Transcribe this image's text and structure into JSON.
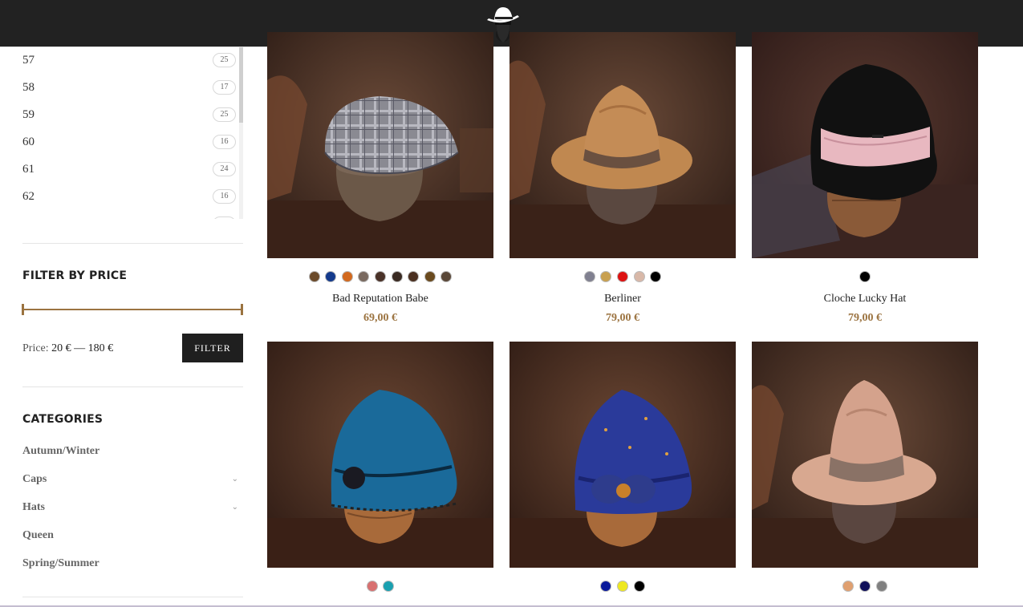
{
  "sizes": [
    {
      "label": "57",
      "count": "25"
    },
    {
      "label": "58",
      "count": "17"
    },
    {
      "label": "59",
      "count": "25"
    },
    {
      "label": "60",
      "count": "16"
    },
    {
      "label": "61",
      "count": "24"
    },
    {
      "label": "62",
      "count": "16"
    }
  ],
  "price_filter": {
    "title": "FILTER BY PRICE",
    "price_prefix": "Price:",
    "price_range": "20 € — 180 €",
    "button": "FILTER"
  },
  "categories": {
    "title": "CATEGORIES",
    "items": [
      {
        "label": "Autumn/Winter"
      },
      {
        "label": "Caps"
      },
      {
        "label": "Hats"
      },
      {
        "label": "Queen"
      },
      {
        "label": "Spring/Summer"
      }
    ]
  },
  "products": [
    {
      "name": "Bad Reputation Babe",
      "price": "69,00 €",
      "swatches": [
        "#6b4a2a",
        "#143a8c",
        "#d2691e",
        "#7a6a60",
        "#4a3228",
        "#3a2a22",
        "#4b3020",
        "#6a4a1e",
        "#5a4838"
      ]
    },
    {
      "name": "Berliner",
      "price": "79,00 €",
      "swatches": [
        "#808090",
        "#c8a050",
        "#dd1111",
        "#d8b8a8",
        "#000000"
      ]
    },
    {
      "name": "Cloche Lucky Hat",
      "price": "79,00 €",
      "swatches": [
        "#000000"
      ]
    },
    {
      "name": "",
      "price": "",
      "swatches": [
        "#d87070",
        "#1aa0b0"
      ]
    },
    {
      "name": "",
      "price": "",
      "swatches": [
        "#0a1a9a",
        "#eee820",
        "#000000"
      ]
    },
    {
      "name": "",
      "price": "",
      "swatches": [
        "#e0a070",
        "#10105a",
        "#808080"
      ]
    }
  ],
  "colors": {
    "header_bg": "#222222",
    "accent": "#9b7340",
    "button_bg": "#1f1f1f"
  }
}
